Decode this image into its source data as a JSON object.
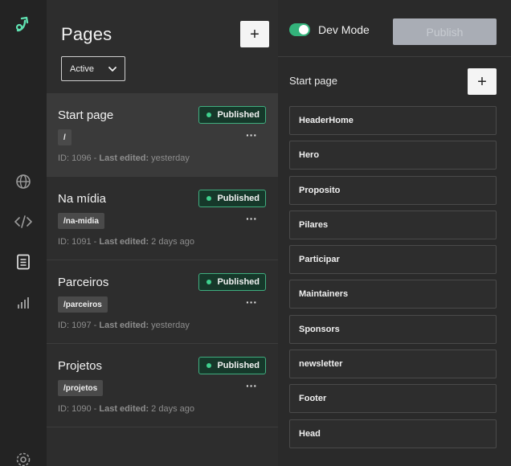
{
  "nav": {
    "logo": "logo-icon",
    "items": [
      {
        "name": "globe-icon"
      },
      {
        "name": "code-icon"
      },
      {
        "name": "pages-icon"
      },
      {
        "name": "analytics-icon"
      },
      {
        "name": "settings-icon"
      }
    ]
  },
  "pages": {
    "title": "Pages",
    "add_label": "+",
    "filter": {
      "value": "Active"
    },
    "items": [
      {
        "name": "Start page",
        "status": "Published",
        "slug": "/",
        "id": "ID: 1096",
        "edited_label": "Last edited:",
        "edited": "yesterday",
        "more": "···"
      },
      {
        "name": "Na mídia",
        "status": "Published",
        "slug": "/na-midia",
        "id": "ID: 1091",
        "edited_label": "Last edited:",
        "edited": "2 days ago",
        "more": "···"
      },
      {
        "name": "Parceiros",
        "status": "Published",
        "slug": "/parceiros",
        "id": "ID: 1097",
        "edited_label": "Last edited:",
        "edited": "yesterday",
        "more": "···"
      },
      {
        "name": "Projetos",
        "status": "Published",
        "slug": "/projetos",
        "id": "ID: 1090",
        "edited_label": "Last edited:",
        "edited": "2 days ago",
        "more": "···"
      }
    ]
  },
  "editor": {
    "dev_mode_label": "Dev Mode",
    "dev_mode_on": true,
    "publish_label": "Publish",
    "page_label": "Start page",
    "add_label": "+",
    "sections": [
      "HeaderHome",
      "Hero",
      "Proposito",
      "Pilares",
      "Participar",
      "Maintainers",
      "Sponsors",
      "newsletter",
      "Footer",
      "Head"
    ]
  },
  "colors": {
    "accent": "#3fd08e",
    "badge_border": "#3fae7f",
    "rail_bg": "#232323",
    "panel_bg": "#2d2d2d"
  }
}
